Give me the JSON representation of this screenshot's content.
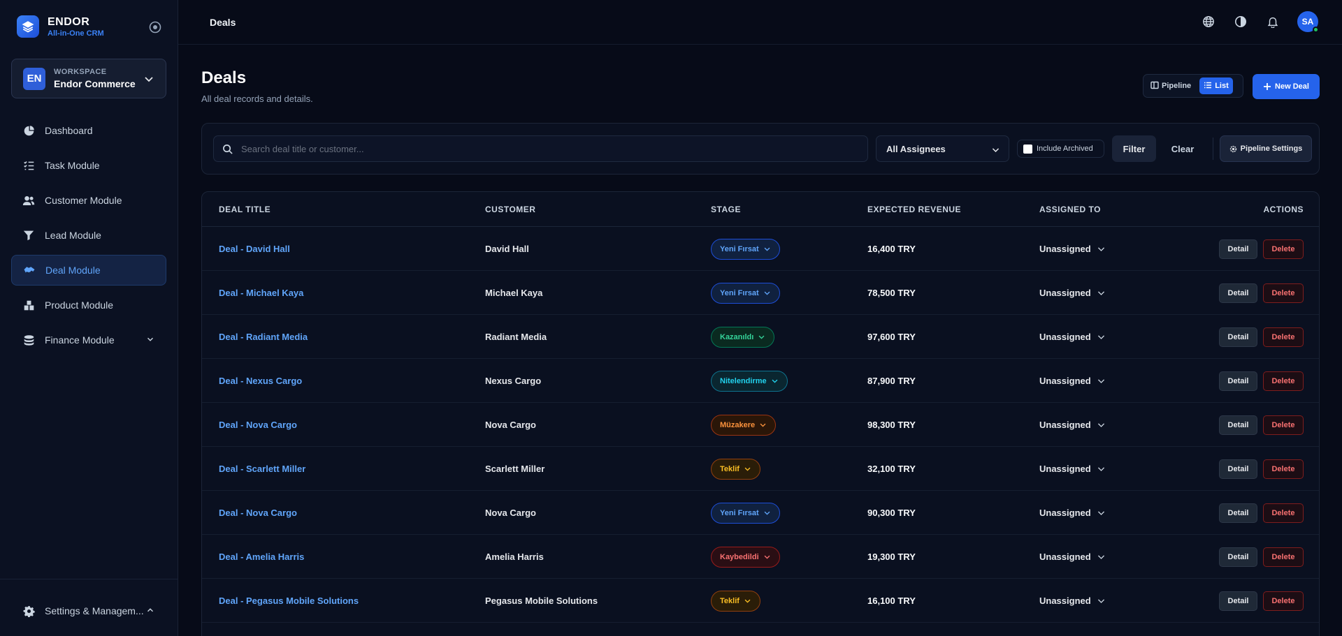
{
  "brand": {
    "name": "ENDOR",
    "subtitle": "All-in-One CRM"
  },
  "workspace": {
    "label": "WORKSPACE",
    "name": "Endor Commerce",
    "initials": "EN"
  },
  "sidebar": {
    "items": [
      {
        "label": "Dashboard",
        "icon": "pie-chart-icon"
      },
      {
        "label": "Task Module",
        "icon": "list-check-icon"
      },
      {
        "label": "Customer Module",
        "icon": "users-icon"
      },
      {
        "label": "Lead Module",
        "icon": "funnel-icon"
      },
      {
        "label": "Deal Module",
        "icon": "handshake-icon",
        "active": true
      },
      {
        "label": "Product Module",
        "icon": "boxes-icon"
      },
      {
        "label": "Finance Module",
        "icon": "coins-icon"
      }
    ],
    "footer_label": "Settings & Managem..."
  },
  "topbar": {
    "breadcrumb": "Deals",
    "avatar_initials": "SA"
  },
  "page": {
    "title": "Deals",
    "subtitle": "All deal records and details."
  },
  "view_toggle": {
    "pipeline": "Pipeline",
    "list": "List"
  },
  "new_deal_label": "New Deal",
  "filters": {
    "search_placeholder": "Search deal title or customer...",
    "assignees": "All Assignees",
    "include_archived": "Include Archived",
    "filter_label": "Filter",
    "clear_label": "Clear",
    "pipeline_settings": "Pipeline Settings"
  },
  "table": {
    "columns": [
      "DEAL TITLE",
      "CUSTOMER",
      "STAGE",
      "EXPECTED REVENUE",
      "ASSIGNED TO",
      "ACTIONS"
    ],
    "rows": [
      {
        "title": "Deal - David Hall",
        "customer": "David Hall",
        "stage": "Yeni Fırsat",
        "stage_color": "blue",
        "revenue": "16,400 TRY",
        "assigned": "Unassigned"
      },
      {
        "title": "Deal - Michael Kaya",
        "customer": "Michael Kaya",
        "stage": "Yeni Fırsat",
        "stage_color": "blue",
        "revenue": "78,500 TRY",
        "assigned": "Unassigned"
      },
      {
        "title": "Deal - Radiant Media",
        "customer": "Radiant Media",
        "stage": "Kazanıldı",
        "stage_color": "green",
        "revenue": "97,600 TRY",
        "assigned": "Unassigned"
      },
      {
        "title": "Deal - Nexus Cargo",
        "customer": "Nexus Cargo",
        "stage": "Nitelendirme",
        "stage_color": "cyan",
        "revenue": "87,900 TRY",
        "assigned": "Unassigned"
      },
      {
        "title": "Deal - Nova Cargo",
        "customer": "Nova Cargo",
        "stage": "Müzakere",
        "stage_color": "orange",
        "revenue": "98,300 TRY",
        "assigned": "Unassigned"
      },
      {
        "title": "Deal - Scarlett Miller",
        "customer": "Scarlett Miller",
        "stage": "Teklif",
        "stage_color": "amber",
        "revenue": "32,100 TRY",
        "assigned": "Unassigned"
      },
      {
        "title": "Deal - Nova Cargo",
        "customer": "Nova Cargo",
        "stage": "Yeni Fırsat",
        "stage_color": "blue",
        "revenue": "90,300 TRY",
        "assigned": "Unassigned"
      },
      {
        "title": "Deal - Amelia Harris",
        "customer": "Amelia Harris",
        "stage": "Kaybedildi",
        "stage_color": "red",
        "revenue": "19,300 TRY",
        "assigned": "Unassigned"
      },
      {
        "title": "Deal - Pegasus Mobile Solutions",
        "customer": "Pegasus Mobile Solutions",
        "stage": "Teklif",
        "stage_color": "amber",
        "revenue": "16,100 TRY",
        "assigned": "Unassigned"
      }
    ],
    "detail_label": "Detail",
    "delete_label": "Delete"
  },
  "colors": {
    "accent": "#2563eb",
    "background": "#070b18",
    "sidebar": "#0b1122"
  }
}
